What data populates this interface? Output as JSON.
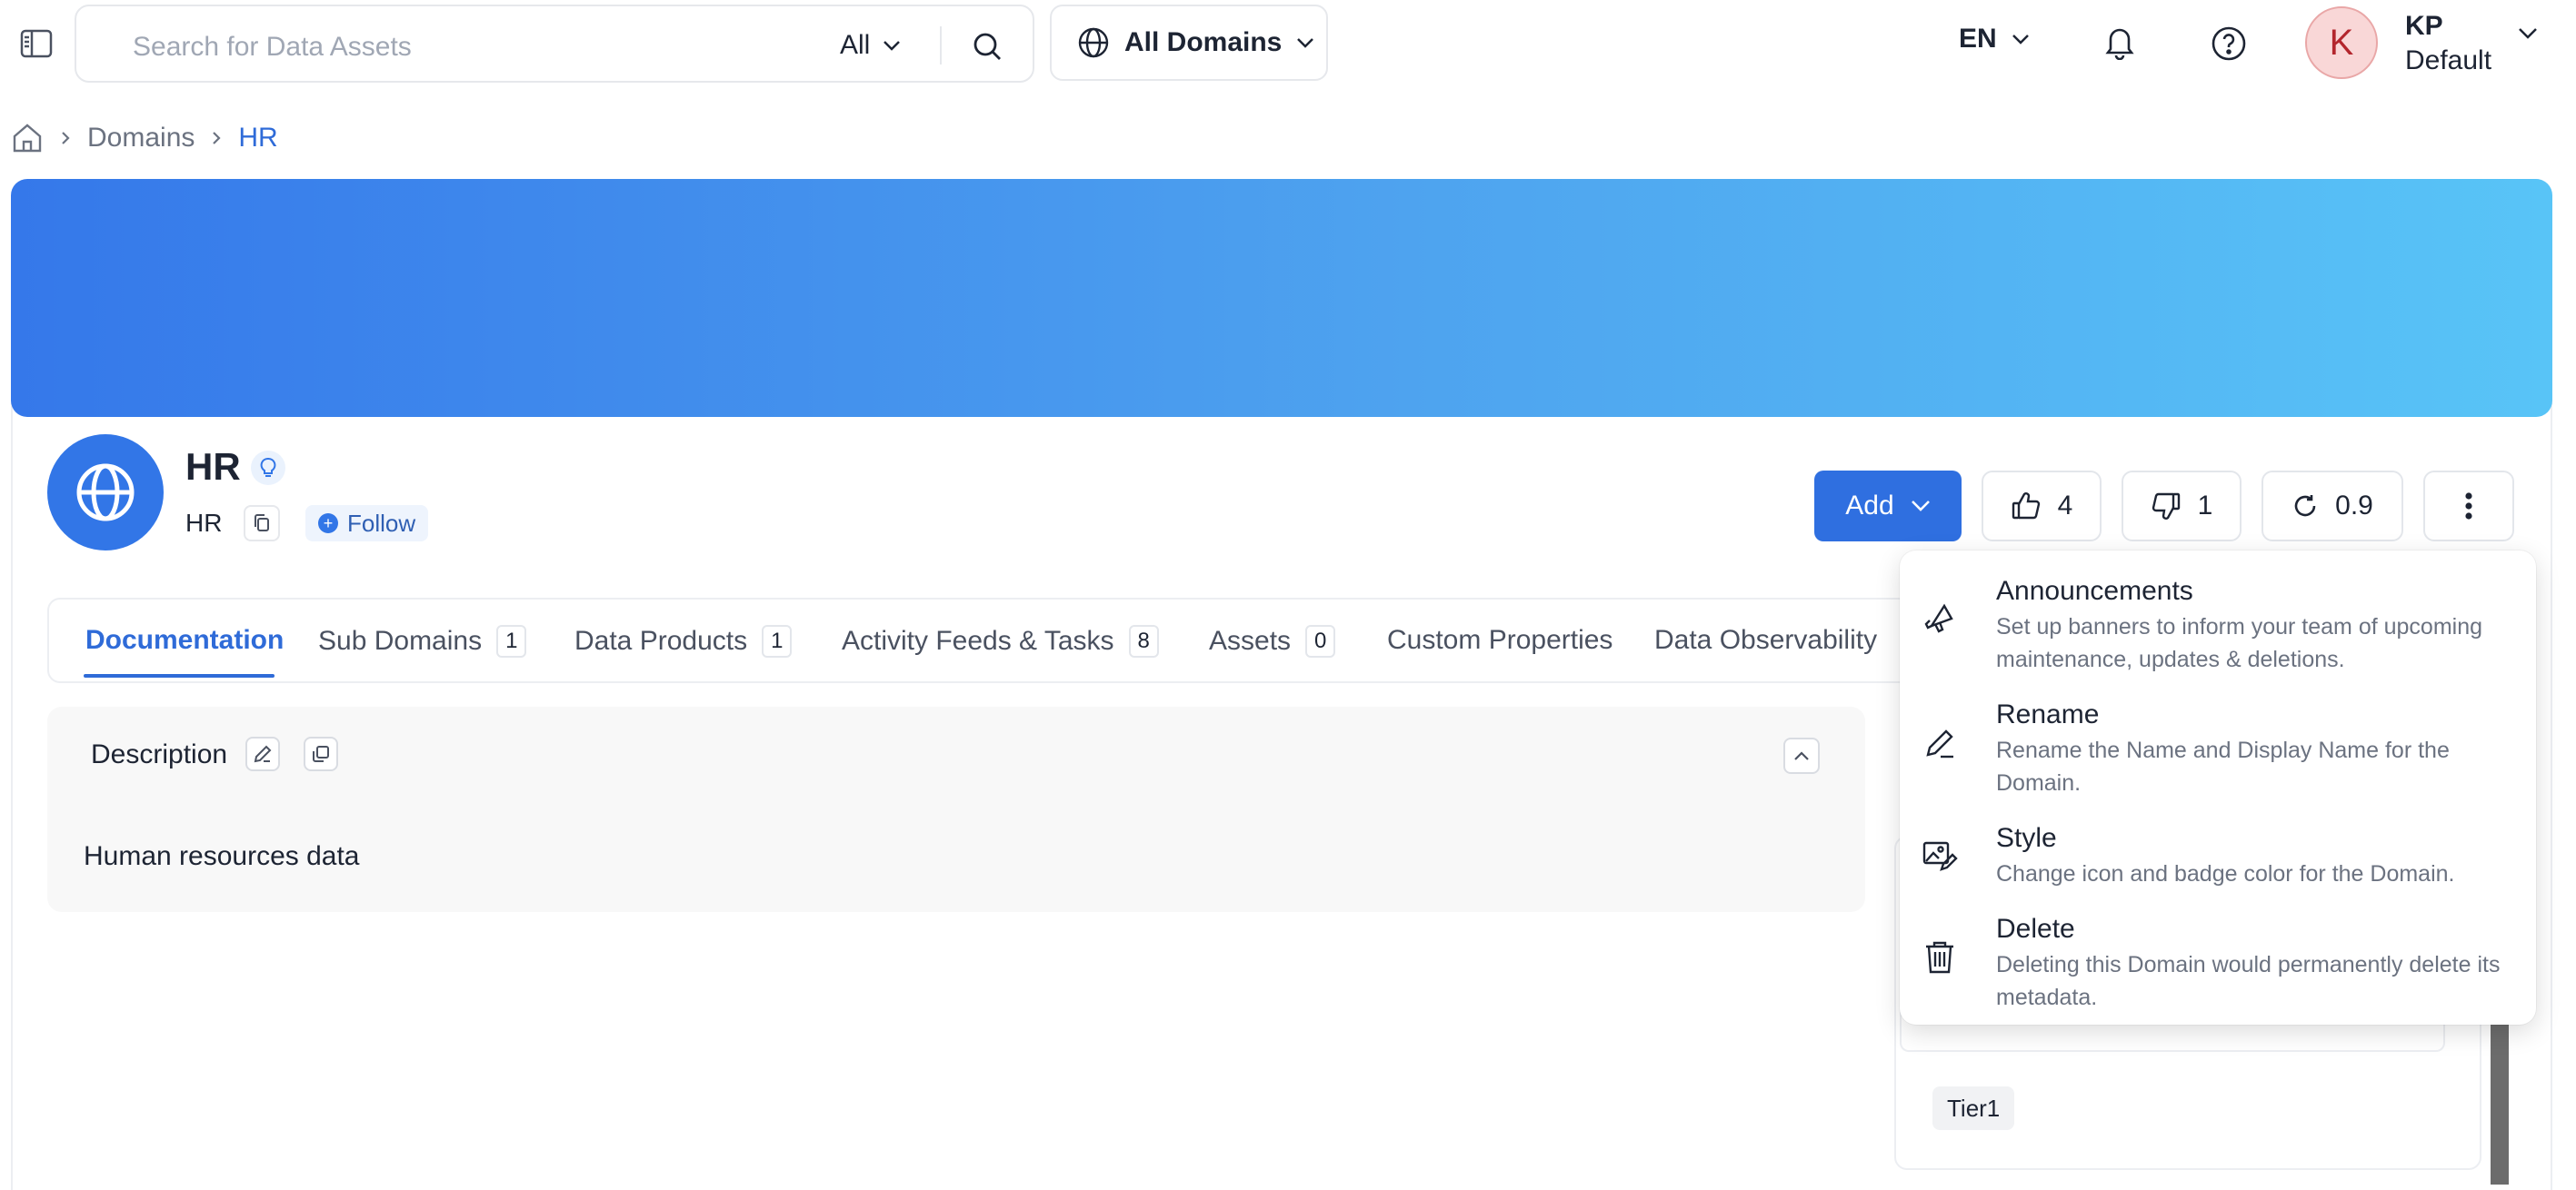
{
  "topbar": {
    "search_placeholder": "Search for Data Assets",
    "search_scope": "All",
    "domain_filter": "All Domains",
    "language": "EN",
    "user_initial": "K",
    "user_name": "KP",
    "user_persona": "Default"
  },
  "breadcrumb": {
    "items": [
      "Domains",
      "HR"
    ]
  },
  "entity": {
    "title": "HR",
    "name": "HR",
    "follow_label": "Follow"
  },
  "actions": {
    "add_label": "Add",
    "upvotes": "4",
    "downvotes": "1",
    "version": "0.9"
  },
  "tabs": [
    {
      "label": "Documentation"
    },
    {
      "label": "Sub Domains",
      "count": "1"
    },
    {
      "label": "Data Products",
      "count": "1"
    },
    {
      "label": "Activity Feeds & Tasks",
      "count": "8"
    },
    {
      "label": "Assets",
      "count": "0"
    },
    {
      "label": "Custom Properties"
    },
    {
      "label": "Data Observability"
    }
  ],
  "description": {
    "label": "Description",
    "text": "Human resources data"
  },
  "right_panel": {
    "tier": "Tier1"
  },
  "menu": {
    "items": [
      {
        "title": "Announcements",
        "description": "Set up banners to inform your team of upcoming maintenance, updates & deletions.",
        "icon": "megaphone-icon"
      },
      {
        "title": "Rename",
        "description": "Rename the Name and Display Name for the Domain.",
        "icon": "pencil-icon"
      },
      {
        "title": "Style",
        "description": "Change icon and badge color for the Domain.",
        "icon": "image-edit-icon"
      },
      {
        "title": "Delete",
        "description": "Deleting this Domain would permanently delete its metadata.",
        "icon": "trash-icon"
      }
    ]
  },
  "colors": {
    "accent": "#2f6fe0",
    "banner_start": "#3578ea",
    "banner_end": "#58c4f7",
    "avatar_bg": "#f9d7d7"
  }
}
